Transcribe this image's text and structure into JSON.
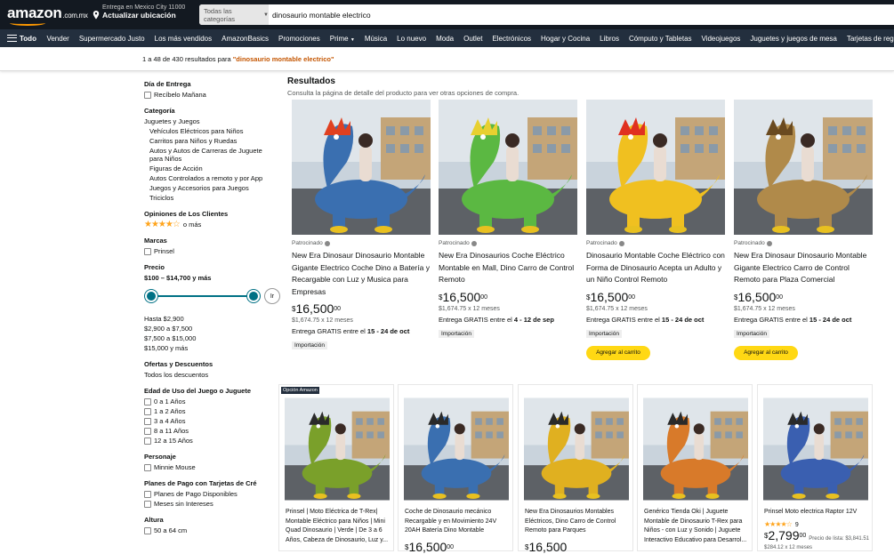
{
  "header": {
    "logo": "amazon",
    "logo_tld": ".com.mx",
    "deliver_line1": "Entrega en Mexico City 11000",
    "deliver_line2": "Actualizar ubicación",
    "search_category": "Todas las categorías",
    "search_value": "dinosaurio montable electrico"
  },
  "nav": {
    "all": "Todo",
    "items": [
      "Vender",
      "Supermercado Justo",
      "Los más vendidos",
      "AmazonBasics",
      "Promociones",
      "Prime",
      "Música",
      "Lo nuevo",
      "Moda",
      "Outlet",
      "Electrónicos",
      "Hogar y Cocina",
      "Libros",
      "Cómputo y Tabletas",
      "Videojuegos",
      "Juguetes y juegos de mesa",
      "Tarjetas de regalo"
    ]
  },
  "results_bar": {
    "prefix": "1 a 48 de 430 resultados para ",
    "query": "\"dinosaurio montable electrico\""
  },
  "sidebar": {
    "delivery_h": "Día de Entrega",
    "delivery_opt": "Recíbelo Mañana",
    "category_h": "Categoría",
    "category_root": "Juguetes y Juegos",
    "categories": [
      "Vehículos Eléctricos para Niños",
      "Carritos para Niños y Ruedas",
      "Autos y Autos de Carreras de Juguete para Niños",
      "Figuras de Acción",
      "Autos Controlados a remoto y por App",
      "Juegos y Accesorios para Juegos",
      "Triciclos"
    ],
    "reviews_h": "Opiniones de Los Clientes",
    "reviews_more": "o más",
    "reviews_stars": 4,
    "brands_h": "Marcas",
    "brand": "Prinsel",
    "price_h": "Precio",
    "price_range": "$100 – $14,700 y más",
    "go": "Ir",
    "price_opts": [
      "Hasta $2,900",
      "$2,900 a $7,500",
      "$7,500 a $15,000",
      "$15,000 y más"
    ],
    "deals_h": "Ofertas y Descuentos",
    "deals_opt": "Todos los descuentos",
    "age_h": "Edad de Uso del Juego o Juguete",
    "ages": [
      "0 a 1 Años",
      "1 a 2 Años",
      "3 a 4 Años",
      "8 a 11 Años",
      "12 a 15 Años"
    ],
    "character_h": "Personaje",
    "character": "Minnie Mouse",
    "plans_h": "Planes de Pago con Tarjetas de Cré",
    "plans": [
      "Planes de Pago Disponibles",
      "Meses sin Intereses"
    ],
    "height_h": "Altura",
    "height_opt": "50 a 64 cm"
  },
  "main": {
    "heading": "Resultados",
    "subheading": "Consulta la página de detalle del producto para ver otras opciones de compra."
  },
  "sponsored_label": "Patrocinado",
  "cart_label": "Agregar al carrito",
  "products": [
    {
      "title": "New Era Dinosaur Dinosaurio Montable Gigante Electrico Coche Dino a Batería y Recargable con Luz y Musica para Empresas",
      "price_whole": "16,500",
      "price_cents": "00",
      "monthly": "$1,674.75 x 12 meses",
      "delivery_prefix": "Entrega GRATIS entre el ",
      "delivery_dates": "15 - 24 de oct",
      "badge": "Importación",
      "cart": false,
      "dino": "#3a6fb0",
      "accent": "#e04020"
    },
    {
      "title": "New Era Dinosaurios Coche Eléctrico Montable en Mall, Dino Carro de Control Remoto",
      "price_whole": "16,500",
      "price_cents": "00",
      "monthly": "$1,674.75 x 12 meses",
      "delivery_prefix": "Entrega GRATIS entre el ",
      "delivery_dates": "4 - 12 de sep",
      "badge": "Importación",
      "cart": false,
      "dino": "#5bb842",
      "accent": "#e8d030"
    },
    {
      "title": "Dinosaurio Montable Coche Eléctrico con Forma de Dinosaurio Acepta un Adulto y un Niño Control Remoto",
      "price_whole": "16,500",
      "price_cents": "00",
      "monthly": "$1,674.75 x 12 meses",
      "delivery_prefix": "Entrega GRATIS entre el ",
      "delivery_dates": "15 - 24 de oct",
      "badge": "Importación",
      "cart": true,
      "dino": "#f0c020",
      "accent": "#e03020"
    },
    {
      "title": "New Era Dinosaur Dinosaurio Montable Gigante Electrico Carro de Control Remoto para Plaza Comercial",
      "price_whole": "16,500",
      "price_cents": "00",
      "monthly": "$1,674.75 x 12 meses",
      "delivery_prefix": "Entrega GRATIS entre el ",
      "delivery_dates": "15 - 24 de oct",
      "badge": "Importación",
      "cart": true,
      "dino": "#b08a4a",
      "accent": "#6a4a20"
    }
  ],
  "row2": [
    {
      "title": "Prinsel | Moto Eléctrica de T-Rex| Montable Eléctrico para Niños | Mini Quad Dinosaurio | Verde | De 3 a 6 Años, Cabeza de Dinosaurio, Luz y...",
      "price_whole": "",
      "price_cents": "",
      "badge": "Opción Amazon",
      "color": "#7aa02a"
    },
    {
      "title": "Coche de Dinosaurio mecánico Recargable y en Movimiento 24V 20AH Batería Dino Montable",
      "price_whole": "16,500",
      "price_cents": "00",
      "badge": "",
      "color": "#3a6fb0"
    },
    {
      "title": "New Era Dinosaurios Montables Eléctricos, Dino Carro de Control Remoto para Parques",
      "price_whole": "16,500",
      "price_cents": "",
      "badge": "",
      "color": "#e0b020"
    },
    {
      "title": "Genérico Tienda Oki | Juguete Montable de Dinosaurio T-Rex para Niños - con Luz y Sonido | Juguete Interactivo Educativo para Desarrol...",
      "price_whole": "",
      "price_cents": "",
      "badge": "",
      "color": "#d87a2a"
    },
    {
      "title": "Prinsel Moto electrica Raptor 12V",
      "price_whole": "2,799",
      "price_cents": "00",
      "list_price": "Precio de lista: $3,841.51",
      "monthly": "$284.12 x 12 meses",
      "rating_count": "9",
      "badge": "",
      "color": "#3a5fb0"
    }
  ],
  "colors": {
    "header": "#131921",
    "nav": "#232f3e",
    "accent": "#ff9900",
    "link": "#007185",
    "query": "#c45500",
    "cart": "#ffd814"
  }
}
